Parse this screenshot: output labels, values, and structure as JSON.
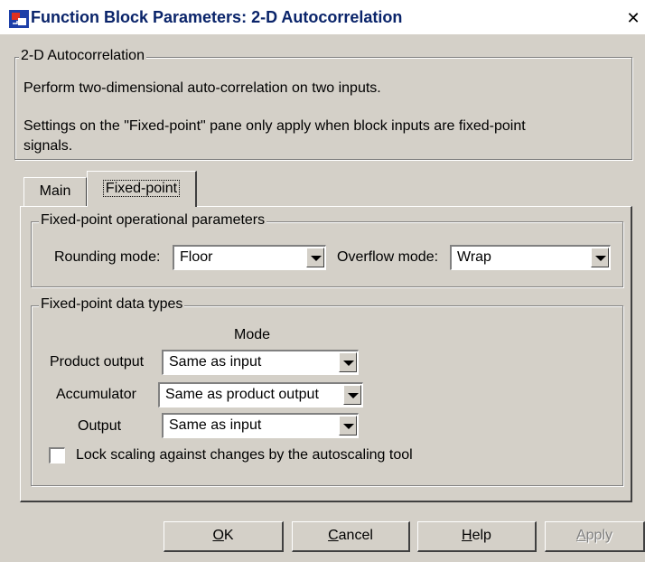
{
  "window": {
    "title": "Function Block Parameters: 2-D Autocorrelation",
    "close_glyph": "✕"
  },
  "description": {
    "group_label": "2-D Autocorrelation",
    "line1": "Perform two-dimensional auto-correlation on two inputs.",
    "line2": "Settings on the \"Fixed-point\" pane only apply when block inputs are fixed-point",
    "line3": "signals."
  },
  "tabs": [
    {
      "label": "Main",
      "active": false
    },
    {
      "label": "Fixed-point",
      "active": true
    }
  ],
  "operational": {
    "group_label": "Fixed-point operational parameters",
    "rounding_label": "Rounding mode:",
    "rounding_value": "Floor",
    "overflow_label": "Overflow mode:",
    "overflow_value": "Wrap"
  },
  "datatypes": {
    "group_label": "Fixed-point data types",
    "mode_header": "Mode",
    "rows": [
      {
        "label": "Product output",
        "value": "Same as input"
      },
      {
        "label": "Accumulator",
        "value": "Same as product output"
      },
      {
        "label": "Output",
        "value": "Same as input"
      }
    ],
    "lock_label": "Lock scaling against changes by the autoscaling tool",
    "lock_checked": false
  },
  "buttons": {
    "ok": {
      "mnemonic": "O",
      "rest": "K"
    },
    "cancel": {
      "mnemonic": "C",
      "rest": "ancel"
    },
    "help": {
      "mnemonic": "H",
      "rest": "elp"
    },
    "apply": {
      "mnemonic": "A",
      "rest": "pply",
      "enabled": false
    }
  },
  "icons": {
    "title_icon": "simulink-block-icon",
    "dropdown": "chevron-down-icon"
  }
}
